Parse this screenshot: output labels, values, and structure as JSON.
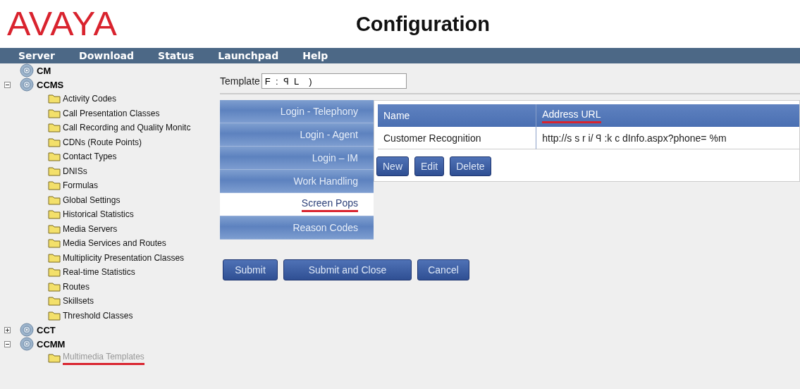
{
  "logo": "AVAYA",
  "title": "Configuration",
  "menu": [
    "Server",
    "Download",
    "Status",
    "Launchpad",
    "Help"
  ],
  "tree": [
    {
      "name": "CM"
    },
    {
      "name": "CCMS",
      "expanded": true,
      "children": [
        {
          "name": "Activity Codes",
          "disabled": false,
          "highlighted": false
        },
        {
          "name": "Call Presentation Classes",
          "disabled": false,
          "highlighted": false
        },
        {
          "name": "Call Recording and Quality Monitc",
          "disabled": false,
          "highlighted": false
        },
        {
          "name": "CDNs (Route Points)",
          "disabled": false,
          "highlighted": false
        },
        {
          "name": "Contact Types",
          "disabled": false,
          "highlighted": false
        },
        {
          "name": "DNISs",
          "disabled": false,
          "highlighted": false
        },
        {
          "name": "Formulas",
          "disabled": false,
          "highlighted": false
        },
        {
          "name": "Global Settings",
          "disabled": false,
          "highlighted": false
        },
        {
          "name": "Historical Statistics",
          "disabled": false,
          "highlighted": false
        },
        {
          "name": "Media Servers",
          "disabled": false,
          "highlighted": false
        },
        {
          "name": "Media Services and Routes",
          "disabled": false,
          "highlighted": false
        },
        {
          "name": "Multiplicity Presentation Classes",
          "disabled": false,
          "highlighted": false
        },
        {
          "name": "Real-time Statistics",
          "disabled": false,
          "highlighted": false
        },
        {
          "name": "Routes",
          "disabled": false,
          "highlighted": false
        },
        {
          "name": "Skillsets",
          "disabled": false,
          "highlighted": false
        },
        {
          "name": "Threshold Classes",
          "disabled": false,
          "highlighted": false
        }
      ]
    },
    {
      "name": "CCT",
      "expanded": false
    },
    {
      "name": "CCMM",
      "expanded": true,
      "children": [
        {
          "name": "Multimedia Templates",
          "disabled": true,
          "highlighted": true
        }
      ]
    }
  ],
  "template": {
    "label": "Template",
    "value": "F  :  ꟼ  L    )"
  },
  "tabs": [
    {
      "label": "Login - Telephony",
      "selected": false,
      "highlighted": false
    },
    {
      "label": "Login - Agent",
      "selected": false,
      "highlighted": false
    },
    {
      "label": "Login – IM",
      "selected": false,
      "highlighted": false
    },
    {
      "label": "Work Handling",
      "selected": false,
      "highlighted": false
    },
    {
      "label": "Screen Pops",
      "selected": true,
      "highlighted": true
    },
    {
      "label": "Reason Codes",
      "selected": false,
      "highlighted": false
    }
  ],
  "table": {
    "columns": [
      {
        "label": "Name",
        "highlighted": false
      },
      {
        "label": "Address URL",
        "highlighted": true
      }
    ],
    "rows": [
      [
        "Customer Recognition",
        "http://s   s   r   i/   ꟼ   :k   c      dInfo.aspx?phone= %m"
      ]
    ]
  },
  "table_buttons": [
    "New",
    "Edit",
    "Delete"
  ],
  "buttons": [
    "Submit",
    "Submit and Close",
    "Cancel"
  ]
}
